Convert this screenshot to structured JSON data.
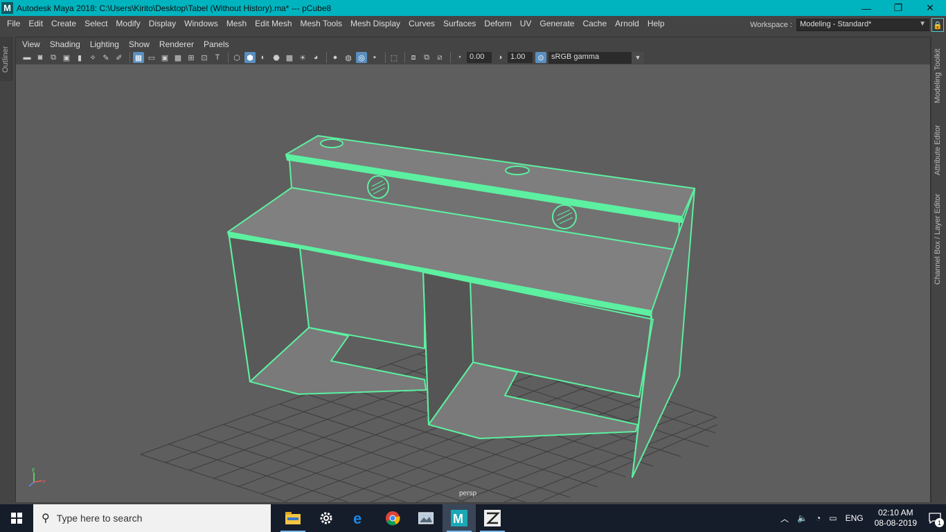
{
  "window": {
    "title": "Autodesk Maya 2018: C:\\Users\\Kirito\\Desktop\\Tabel (Without History).ma*   ---   pCube8",
    "app_icon": "M",
    "minimize": "—",
    "restore": "❐",
    "close": "✕"
  },
  "menubar": {
    "items": [
      "File",
      "Edit",
      "Create",
      "Select",
      "Modify",
      "Display",
      "Windows",
      "Mesh",
      "Edit Mesh",
      "Mesh Tools",
      "Mesh Display",
      "Curves",
      "Surfaces",
      "Deform",
      "UV",
      "Generate",
      "Cache",
      "Arnold",
      "Help"
    ]
  },
  "workspace": {
    "label": "Workspace :",
    "value": "Modeling - Standard*"
  },
  "left_tab": {
    "label": "Outliner"
  },
  "right_tabs": [
    "Modeling Toolkit",
    "Attribute Editor",
    "Channel Box / Layer Editor"
  ],
  "panel": {
    "menu": [
      "View",
      "Shading",
      "Lighting",
      "Show",
      "Renderer",
      "Panels"
    ],
    "exposure": "0.00",
    "gamma": "1.00",
    "color_space": "sRGB gamma",
    "camera_label": "persp",
    "axis": {
      "y": "y",
      "x": "x",
      "z": "z"
    }
  },
  "colors": {
    "wireframe": "#5cf0a0",
    "viewport_bg": "#5e5e5e",
    "titlebar": "#00b4bf",
    "mesh_face": "#808080"
  },
  "taskbar": {
    "search_placeholder": "Type here to search",
    "apps": [
      "file-explorer-icon",
      "settings-icon",
      "edge-icon",
      "chrome-icon",
      "photos-icon",
      "maya-icon",
      "zbrush-icon"
    ],
    "language": "ENG",
    "time": "02:10 AM",
    "date": "08-08-2019",
    "notifications": "1"
  }
}
